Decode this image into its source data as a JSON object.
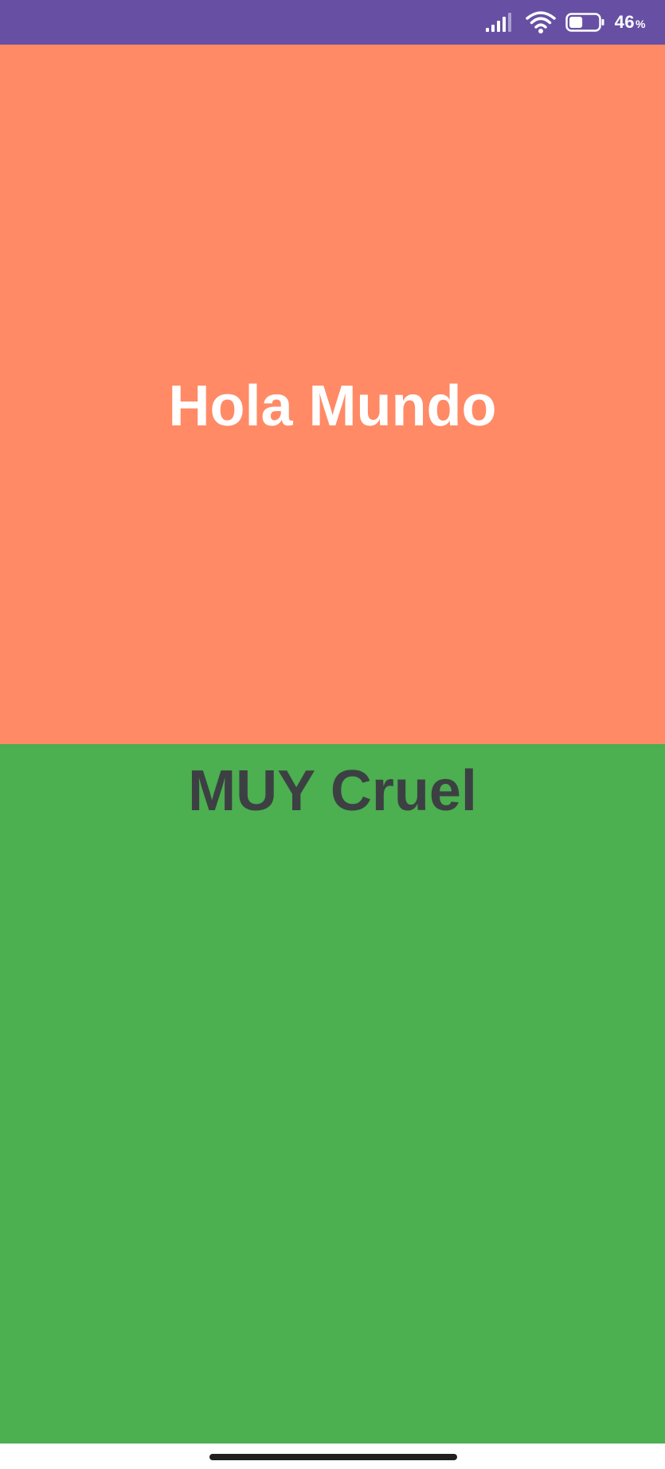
{
  "status_bar": {
    "battery_level": "46",
    "battery_unit": "%",
    "battery_fraction": 0.46,
    "icons": [
      "signal-icon",
      "wifi-icon",
      "battery-icon"
    ],
    "background_color": "#6750A4"
  },
  "top_panel": {
    "text": "Hola Mundo",
    "background_color": "#FF8A65",
    "text_color": "#FFFFFF"
  },
  "bottom_panel": {
    "text": "MUY Cruel",
    "background_color": "#4CAF50",
    "text_color": "#3C4043"
  }
}
